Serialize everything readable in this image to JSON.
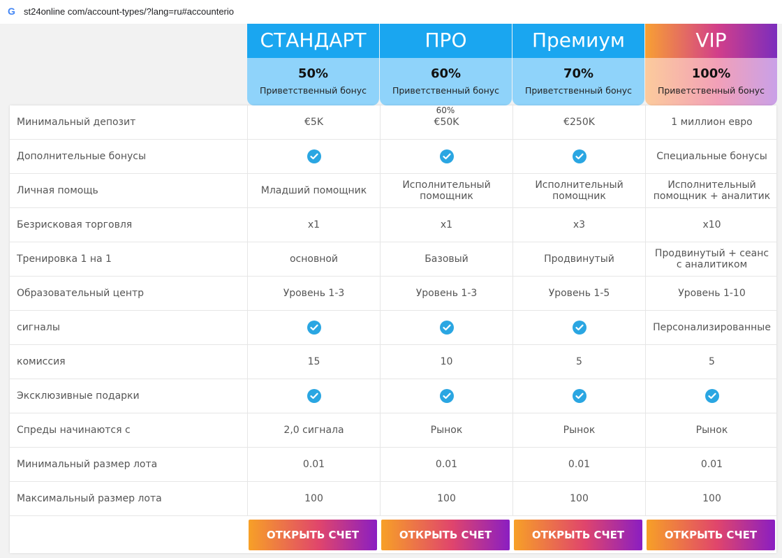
{
  "browser": {
    "url": "st24online com/account-types/?lang=ru#accounterio",
    "engine_icon": "G"
  },
  "plans": [
    {
      "name": "СТАНДАРТ",
      "bonus_pct": "50%",
      "bonus_label": "Приветственный бонус",
      "style": "blue"
    },
    {
      "name": "ПРО",
      "bonus_pct": "60%",
      "bonus_label": "Приветственный бонус",
      "style": "blue"
    },
    {
      "name": "Премиум",
      "bonus_pct": "70%",
      "bonus_label": "Приветственный бонус",
      "style": "blue"
    },
    {
      "name": "VIP",
      "bonus_pct": "100%",
      "bonus_label": "Приветственный бонус",
      "style": "vip"
    }
  ],
  "note_above_pro_deposit": "60%",
  "rows": [
    {
      "label": "Минимальный депозит",
      "values": [
        "€5K",
        "€50K",
        "€250K",
        "1 миллион евро"
      ]
    },
    {
      "label": "Дополнительные бонусы",
      "values": [
        "check",
        "check",
        "check",
        "Специальные бонусы"
      ]
    },
    {
      "label": "Личная помощь",
      "values": [
        "Младший помощник",
        "Исполнительный помощник",
        "Исполнительный помощник",
        "Исполнительный помощник + аналитик"
      ]
    },
    {
      "label": "Безрисковая торговля",
      "values": [
        "x1",
        "x1",
        "x3",
        "x10"
      ]
    },
    {
      "label": "Тренировка 1 на 1",
      "values": [
        "основной",
        "Базовый",
        "Продвинутый",
        "Продвинутый + сеанс с аналитиком"
      ]
    },
    {
      "label": "Образовательный центр",
      "values": [
        "Уровень 1-3",
        "Уровень 1-3",
        "Уровень 1-5",
        "Уровень 1-10"
      ]
    },
    {
      "label": "сигналы",
      "values": [
        "check",
        "check",
        "check",
        "Персонализированные"
      ]
    },
    {
      "label": "комиссия",
      "values": [
        "15",
        "10",
        "5",
        "5"
      ]
    },
    {
      "label": "Эксклюзивные подарки",
      "values": [
        "check",
        "check",
        "check",
        "check"
      ]
    },
    {
      "label": "Спреды начинаются с",
      "values": [
        "2,0 сигнала",
        "Рынок",
        "Рынок",
        "Рынок"
      ]
    },
    {
      "label": "Минимальный размер лота",
      "values": [
        "0.01",
        "0.01",
        "0.01",
        "0.01"
      ]
    },
    {
      "label": "Максимальный размер лота",
      "values": [
        "100",
        "100",
        "100",
        "100"
      ]
    }
  ],
  "open_account_label": "ОТКРЫТЬ СЧЕТ",
  "colors": {
    "check": "#2aa6e2",
    "plan_blue": "#1aa6f0",
    "plan_blue_light": "#8fd3fa"
  }
}
